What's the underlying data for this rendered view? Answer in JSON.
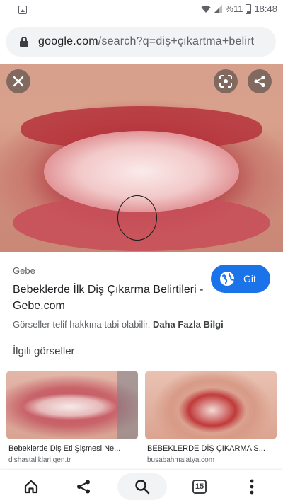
{
  "status_bar": {
    "battery_percent": "%11",
    "time": "18:48",
    "icons": [
      "image-icon",
      "wifi-icon",
      "signal-icon",
      "battery-icon"
    ]
  },
  "url_bar": {
    "domain": "google.com",
    "path": "/search?q=diş+çıkartma+belirt"
  },
  "image_viewer": {
    "icons": [
      "close-icon",
      "lens-icon",
      "share-icon"
    ],
    "source": "Gebe",
    "title": "Bebeklerde İlk Diş Çıkarma Belirtileri - Gebe.com",
    "go_label": "Git",
    "copyright_text": "Görseller telif hakkına tabi olabilir.",
    "more_info": "Daha Fazla Bilgi"
  },
  "related": {
    "title": "İlgili görseller",
    "items": [
      {
        "title": "Bebeklerde Diş Eti Şişmesi Ne...",
        "source": "dishastaliklari.gen.tr"
      },
      {
        "title": "BEBEKLERDE DİŞ ÇIKARMA S...",
        "source": "busabahmalatya.com"
      }
    ]
  },
  "bottom_nav": {
    "tab_count": "15",
    "icons": [
      "home-icon",
      "share-icon",
      "search-icon",
      "tabs-icon",
      "menu-icon"
    ]
  },
  "colors": {
    "accent": "#1a73e8",
    "url_bar_bg": "#f1f3f4",
    "text_primary": "#202124",
    "text_secondary": "#5f6368"
  }
}
